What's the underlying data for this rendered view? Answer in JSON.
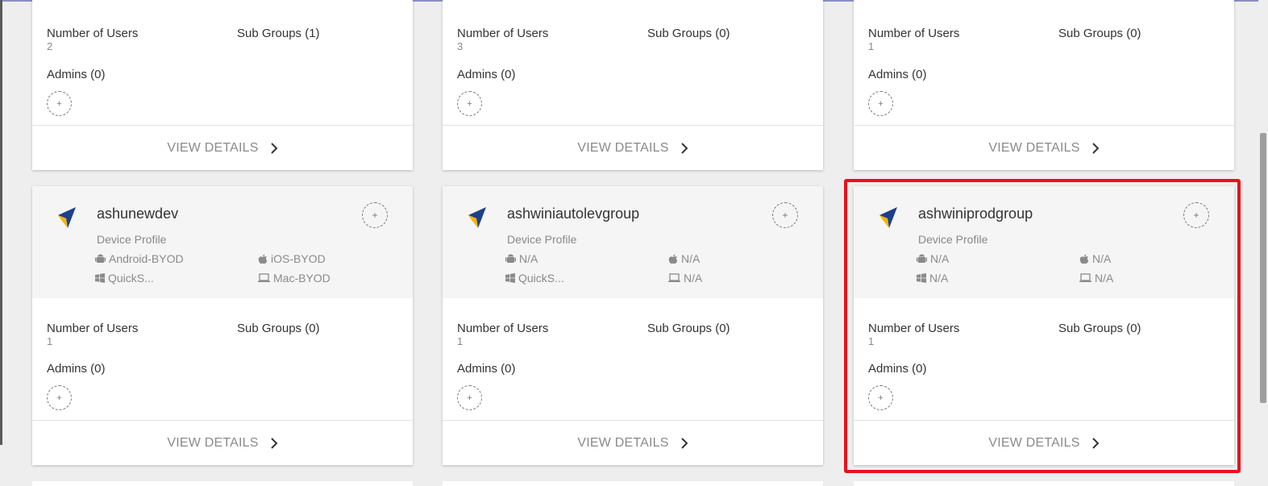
{
  "labels": {
    "number_of_users": "Number of Users",
    "device_profile": "Device Profile",
    "view_details": "VIEW DETAILS",
    "add": "+"
  },
  "top_cards": [
    {
      "users": "2",
      "sub_groups": "Sub Groups (1)",
      "admins": "Admins (0)"
    },
    {
      "users": "3",
      "sub_groups": "Sub Groups (0)",
      "admins": "Admins (0)"
    },
    {
      "users": "1",
      "sub_groups": "Sub Groups (0)",
      "admins": "Admins (0)"
    }
  ],
  "groups": [
    {
      "name": "ashunewdev",
      "android": "Android-BYOD",
      "ios": "iOS-BYOD",
      "windows": "QuickS...",
      "mac": "Mac-BYOD",
      "users": "1",
      "sub_groups": "Sub Groups (0)",
      "admins": "Admins (0)"
    },
    {
      "name": "ashwiniautolevgroup",
      "android": "N/A",
      "ios": "N/A",
      "windows": "QuickS...",
      "mac": "N/A",
      "users": "1",
      "sub_groups": "Sub Groups (0)",
      "admins": "Admins (0)"
    },
    {
      "name": "ashwiniprodgroup",
      "android": "N/A",
      "ios": "N/A",
      "windows": "N/A",
      "mac": "N/A",
      "users": "1",
      "sub_groups": "Sub Groups (0)",
      "admins": "Admins (0)"
    }
  ],
  "colors": {
    "logo_blue": "#1e3f8a",
    "logo_yellow": "#f2b705",
    "highlight": "#e8121b"
  }
}
